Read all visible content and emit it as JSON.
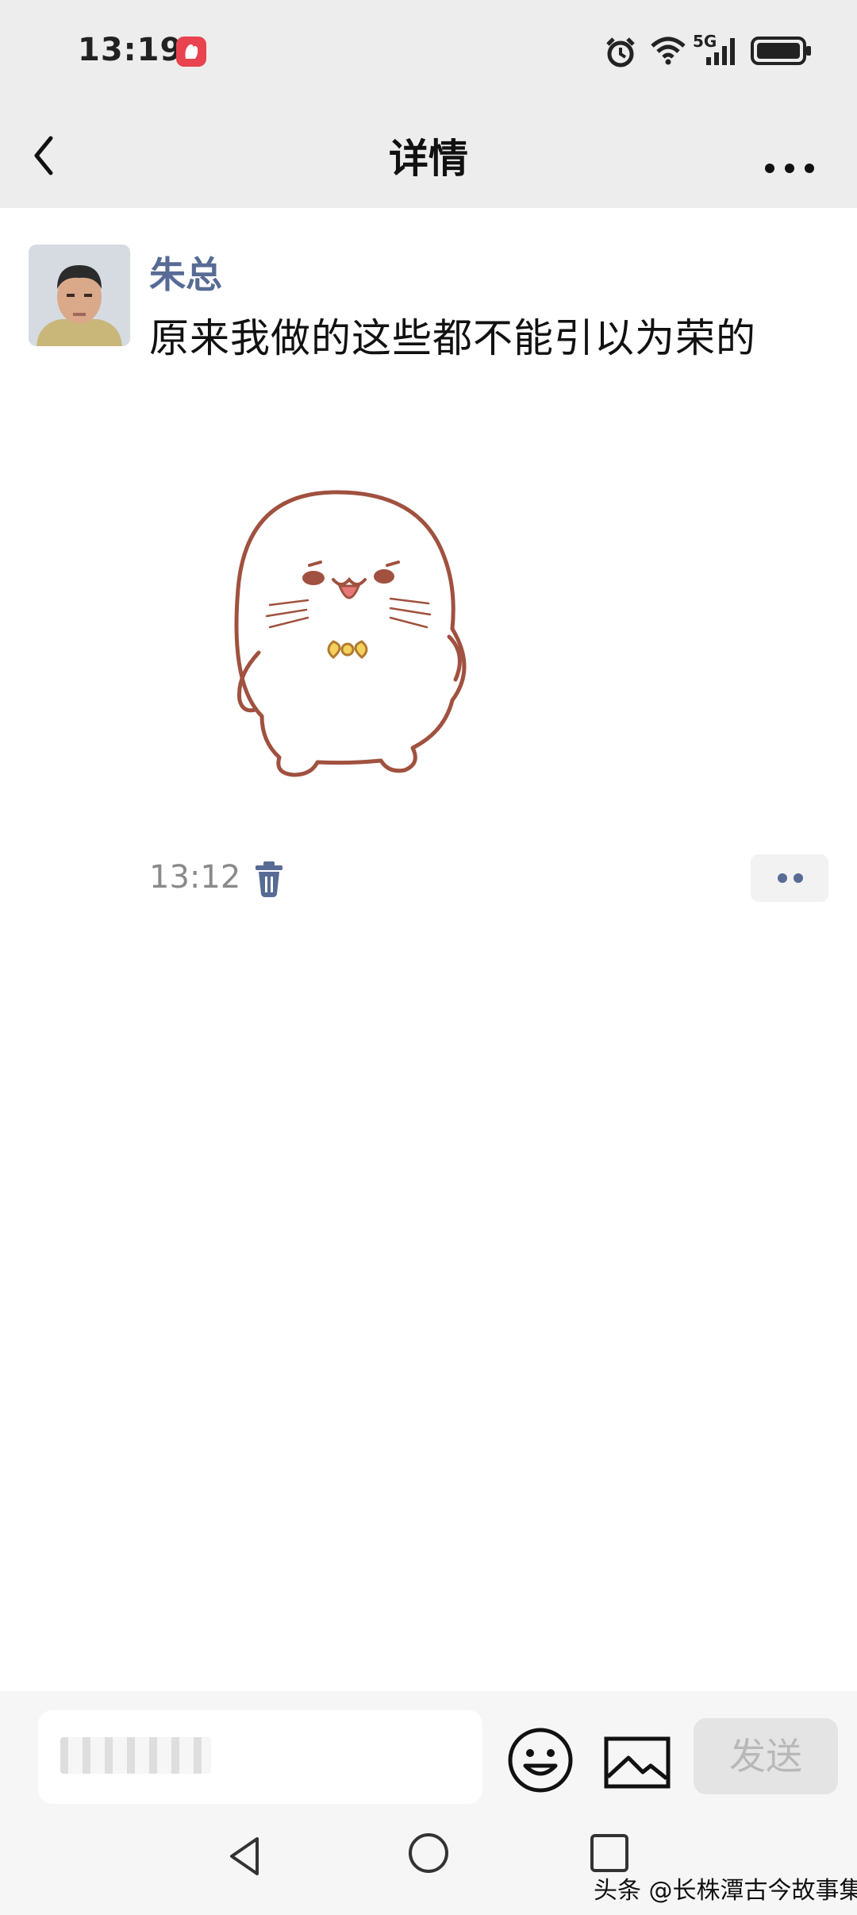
{
  "status_bar": {
    "time": "13:19",
    "network": "5G",
    "icons": [
      "app-notification-icon",
      "alarm-icon",
      "wifi-icon",
      "signal-icon",
      "battery-icon"
    ]
  },
  "header": {
    "title": "详情",
    "back_icon": "chevron-left-icon",
    "more_icon": "more-dots-icon"
  },
  "post": {
    "author": "朱总",
    "text": "原来我做的这些都不能引以为荣的",
    "sticker": "seal-sticker",
    "time": "13:12",
    "delete_icon": "trash-icon",
    "comment_icon": "two-dots-icon"
  },
  "input": {
    "placeholder": "",
    "emoji_icon": "emoji-smile-icon",
    "image_icon": "image-icon",
    "send_label": "发送"
  },
  "watermark": "头条 @长株潭古今故事集",
  "colors": {
    "author_name": "#576b95",
    "header_bg": "#ededed",
    "icon_blue": "#576b95"
  }
}
